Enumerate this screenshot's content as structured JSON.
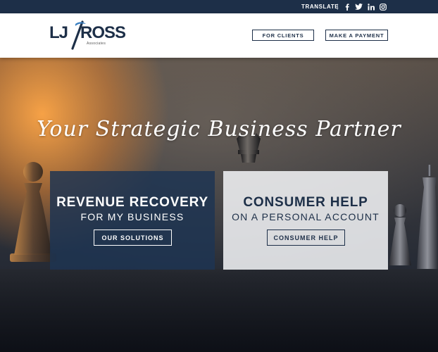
{
  "topbar": {
    "translate_label": "TRANSLATE",
    "separator": "|",
    "social": [
      "facebook-icon",
      "twitter-icon",
      "linkedin-icon",
      "instagram-icon"
    ]
  },
  "header": {
    "logo": {
      "left": "LJ",
      "right": "ROSS",
      "tagline": "Associates"
    },
    "buttons": {
      "for_clients": "FOR CLIENTS",
      "make_payment": "MAKE A PAYMENT"
    }
  },
  "hero": {
    "tagline": "Your Strategic Business Partner",
    "cards": {
      "revenue": {
        "title": "REVENUE RECOVERY",
        "subtitle": "FOR MY BUSINESS",
        "button": "OUR SOLUTIONS"
      },
      "consumer": {
        "title": "CONSUMER HELP",
        "subtitle": "ON A PERSONAL ACCOUNT",
        "button": "CONSUMER HELP"
      }
    }
  },
  "colors": {
    "navy": "#1d2f48",
    "card_navy": "#1e3452",
    "white": "#ffffff",
    "orange_glow": "#ffa646"
  }
}
